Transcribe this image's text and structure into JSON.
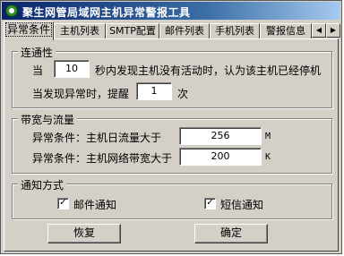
{
  "window": {
    "title": "聚生网管局域网主机异常警报工具"
  },
  "tabs": [
    {
      "label": "异常条件",
      "active": true
    },
    {
      "label": "主机列表",
      "active": false
    },
    {
      "label": "SMTP配置",
      "active": false
    },
    {
      "label": "邮件列表",
      "active": false
    },
    {
      "label": "手机列表",
      "active": false
    },
    {
      "label": "警报信息",
      "active": false
    }
  ],
  "tab_scroll": {
    "left_icon": "arrow-left-icon",
    "right_icon": "arrow-right-icon"
  },
  "connectivity": {
    "legend": "连通性",
    "prefix": "当",
    "seconds_value": "10",
    "suffix": "秒内发现主机没有活动时，认为该主机已经停机",
    "remind_prefix": "当发现异常时，提醒",
    "remind_value": "1",
    "remind_suffix": "次"
  },
  "bandwidth": {
    "legend": "带宽与流量",
    "daily_label": "异常条件：主机日流量大于",
    "daily_value": "256",
    "daily_unit": "M",
    "network_label": "异常条件：主机网络带宽大于",
    "network_value": "200",
    "network_unit": "K"
  },
  "notify": {
    "legend": "通知方式",
    "email_label": "邮件通知",
    "email_checked": true,
    "sms_label": "短信通知",
    "sms_checked": true,
    "check_mark": "✓"
  },
  "buttons": {
    "restore": "恢复",
    "ok": "确定"
  }
}
